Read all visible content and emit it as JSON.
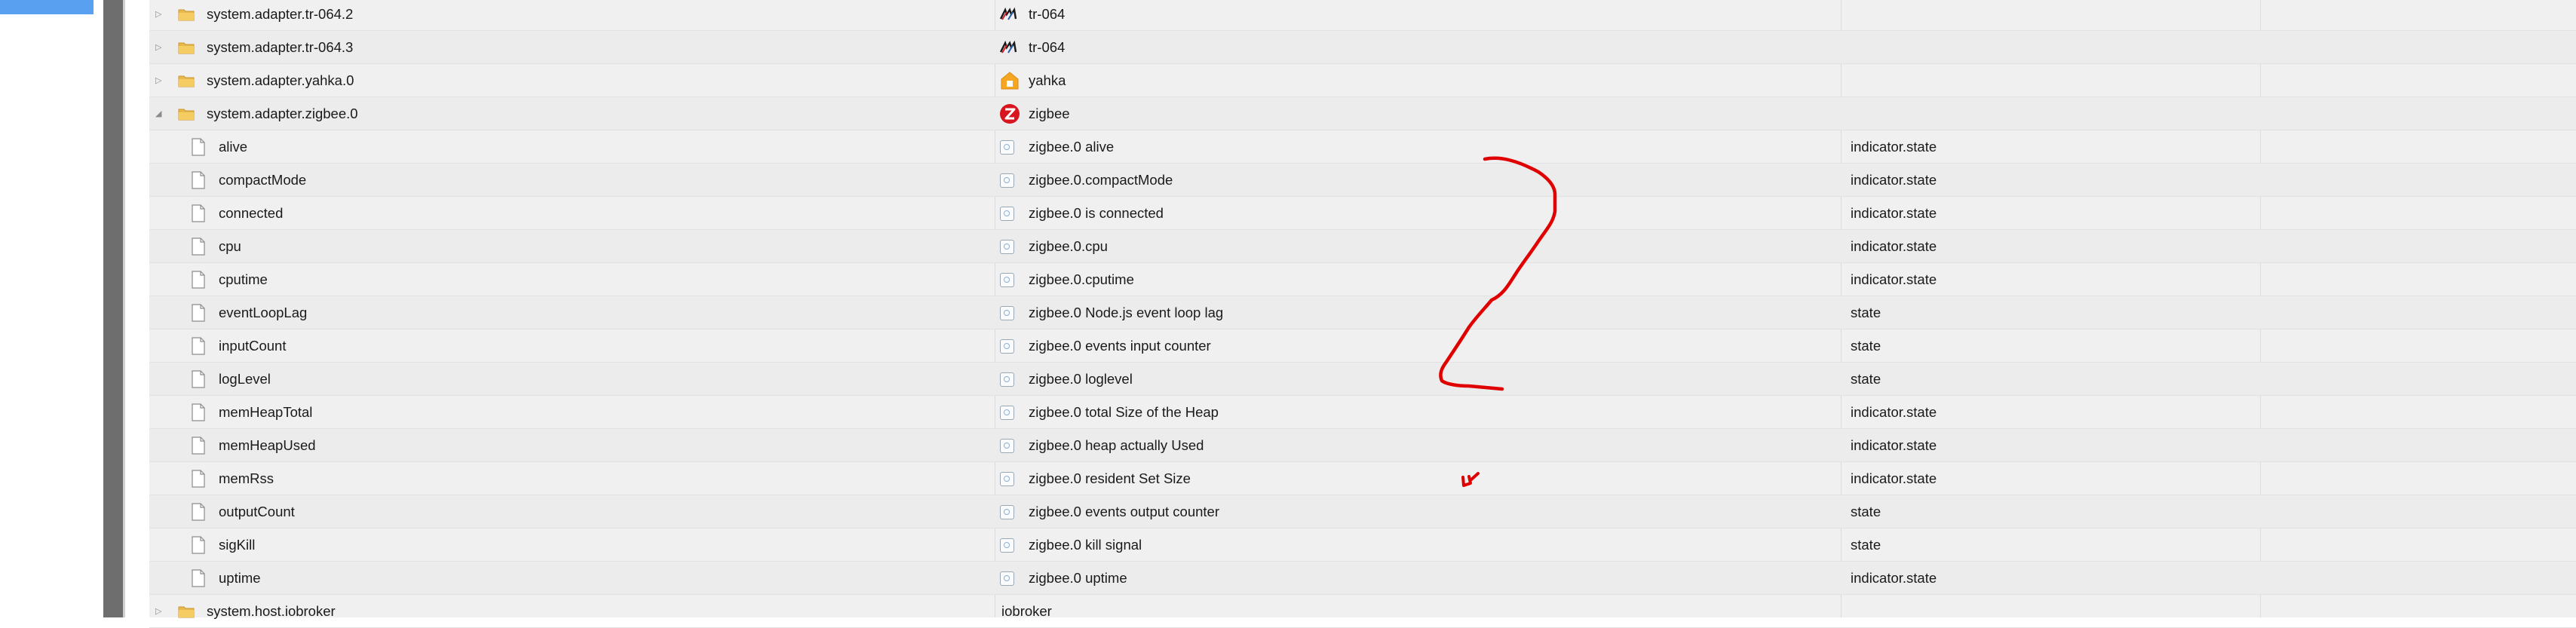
{
  "tree_rows": [
    {
      "kind": "folder",
      "expanded": false,
      "name": "system.adapter.tr-064.2",
      "desc": "tr-064",
      "adapter_icon": "tr064-logo-icon",
      "type": ""
    },
    {
      "kind": "folder",
      "expanded": false,
      "name": "system.adapter.tr-064.3",
      "desc": "tr-064",
      "adapter_icon": "tr064-logo-icon",
      "type": ""
    },
    {
      "kind": "folder",
      "expanded": false,
      "name": "system.adapter.yahka.0",
      "desc": "yahka",
      "adapter_icon": "yahka-home-icon",
      "type": ""
    },
    {
      "kind": "folder",
      "expanded": true,
      "name": "system.adapter.zigbee.0",
      "desc": "zigbee",
      "adapter_icon": "zigbee-logo-icon",
      "type": ""
    },
    {
      "kind": "state",
      "name": "alive",
      "desc": "zigbee.0 alive",
      "type": "indicator.state"
    },
    {
      "kind": "state",
      "name": "compactMode",
      "desc": "zigbee.0.compactMode",
      "type": "indicator.state"
    },
    {
      "kind": "state",
      "name": "connected",
      "desc": "zigbee.0 is connected",
      "type": "indicator.state"
    },
    {
      "kind": "state",
      "name": "cpu",
      "desc": "zigbee.0.cpu",
      "type": "indicator.state"
    },
    {
      "kind": "state",
      "name": "cputime",
      "desc": "zigbee.0.cputime",
      "type": "indicator.state"
    },
    {
      "kind": "state",
      "name": "eventLoopLag",
      "desc": "zigbee.0 Node.js event loop lag",
      "type": "state"
    },
    {
      "kind": "state",
      "name": "inputCount",
      "desc": "zigbee.0 events input counter",
      "type": "state"
    },
    {
      "kind": "state",
      "name": "logLevel",
      "desc": "zigbee.0 loglevel",
      "type": "state"
    },
    {
      "kind": "state",
      "name": "memHeapTotal",
      "desc": "zigbee.0 total Size of the Heap",
      "type": "indicator.state"
    },
    {
      "kind": "state",
      "name": "memHeapUsed",
      "desc": "zigbee.0 heap actually Used",
      "type": "indicator.state"
    },
    {
      "kind": "state",
      "name": "memRss",
      "desc": "zigbee.0 resident Set Size",
      "type": "indicator.state"
    },
    {
      "kind": "state",
      "name": "outputCount",
      "desc": "zigbee.0 events output counter",
      "type": "state"
    },
    {
      "kind": "state",
      "name": "sigKill",
      "desc": "zigbee.0 kill signal",
      "type": "state"
    },
    {
      "kind": "state",
      "name": "uptime",
      "desc": "zigbee.0 uptime",
      "type": "indicator.state"
    },
    {
      "kind": "folder",
      "expanded": false,
      "name": "system.host.iobroker",
      "desc": "iobroker",
      "adapter_icon": "",
      "type": ""
    }
  ],
  "colors": {
    "selection": "#5aa0f0",
    "splitter": "#6e6e6e",
    "folder": "#e8b84a",
    "annotation": "#e00000",
    "zigbee": "#d8141e"
  }
}
